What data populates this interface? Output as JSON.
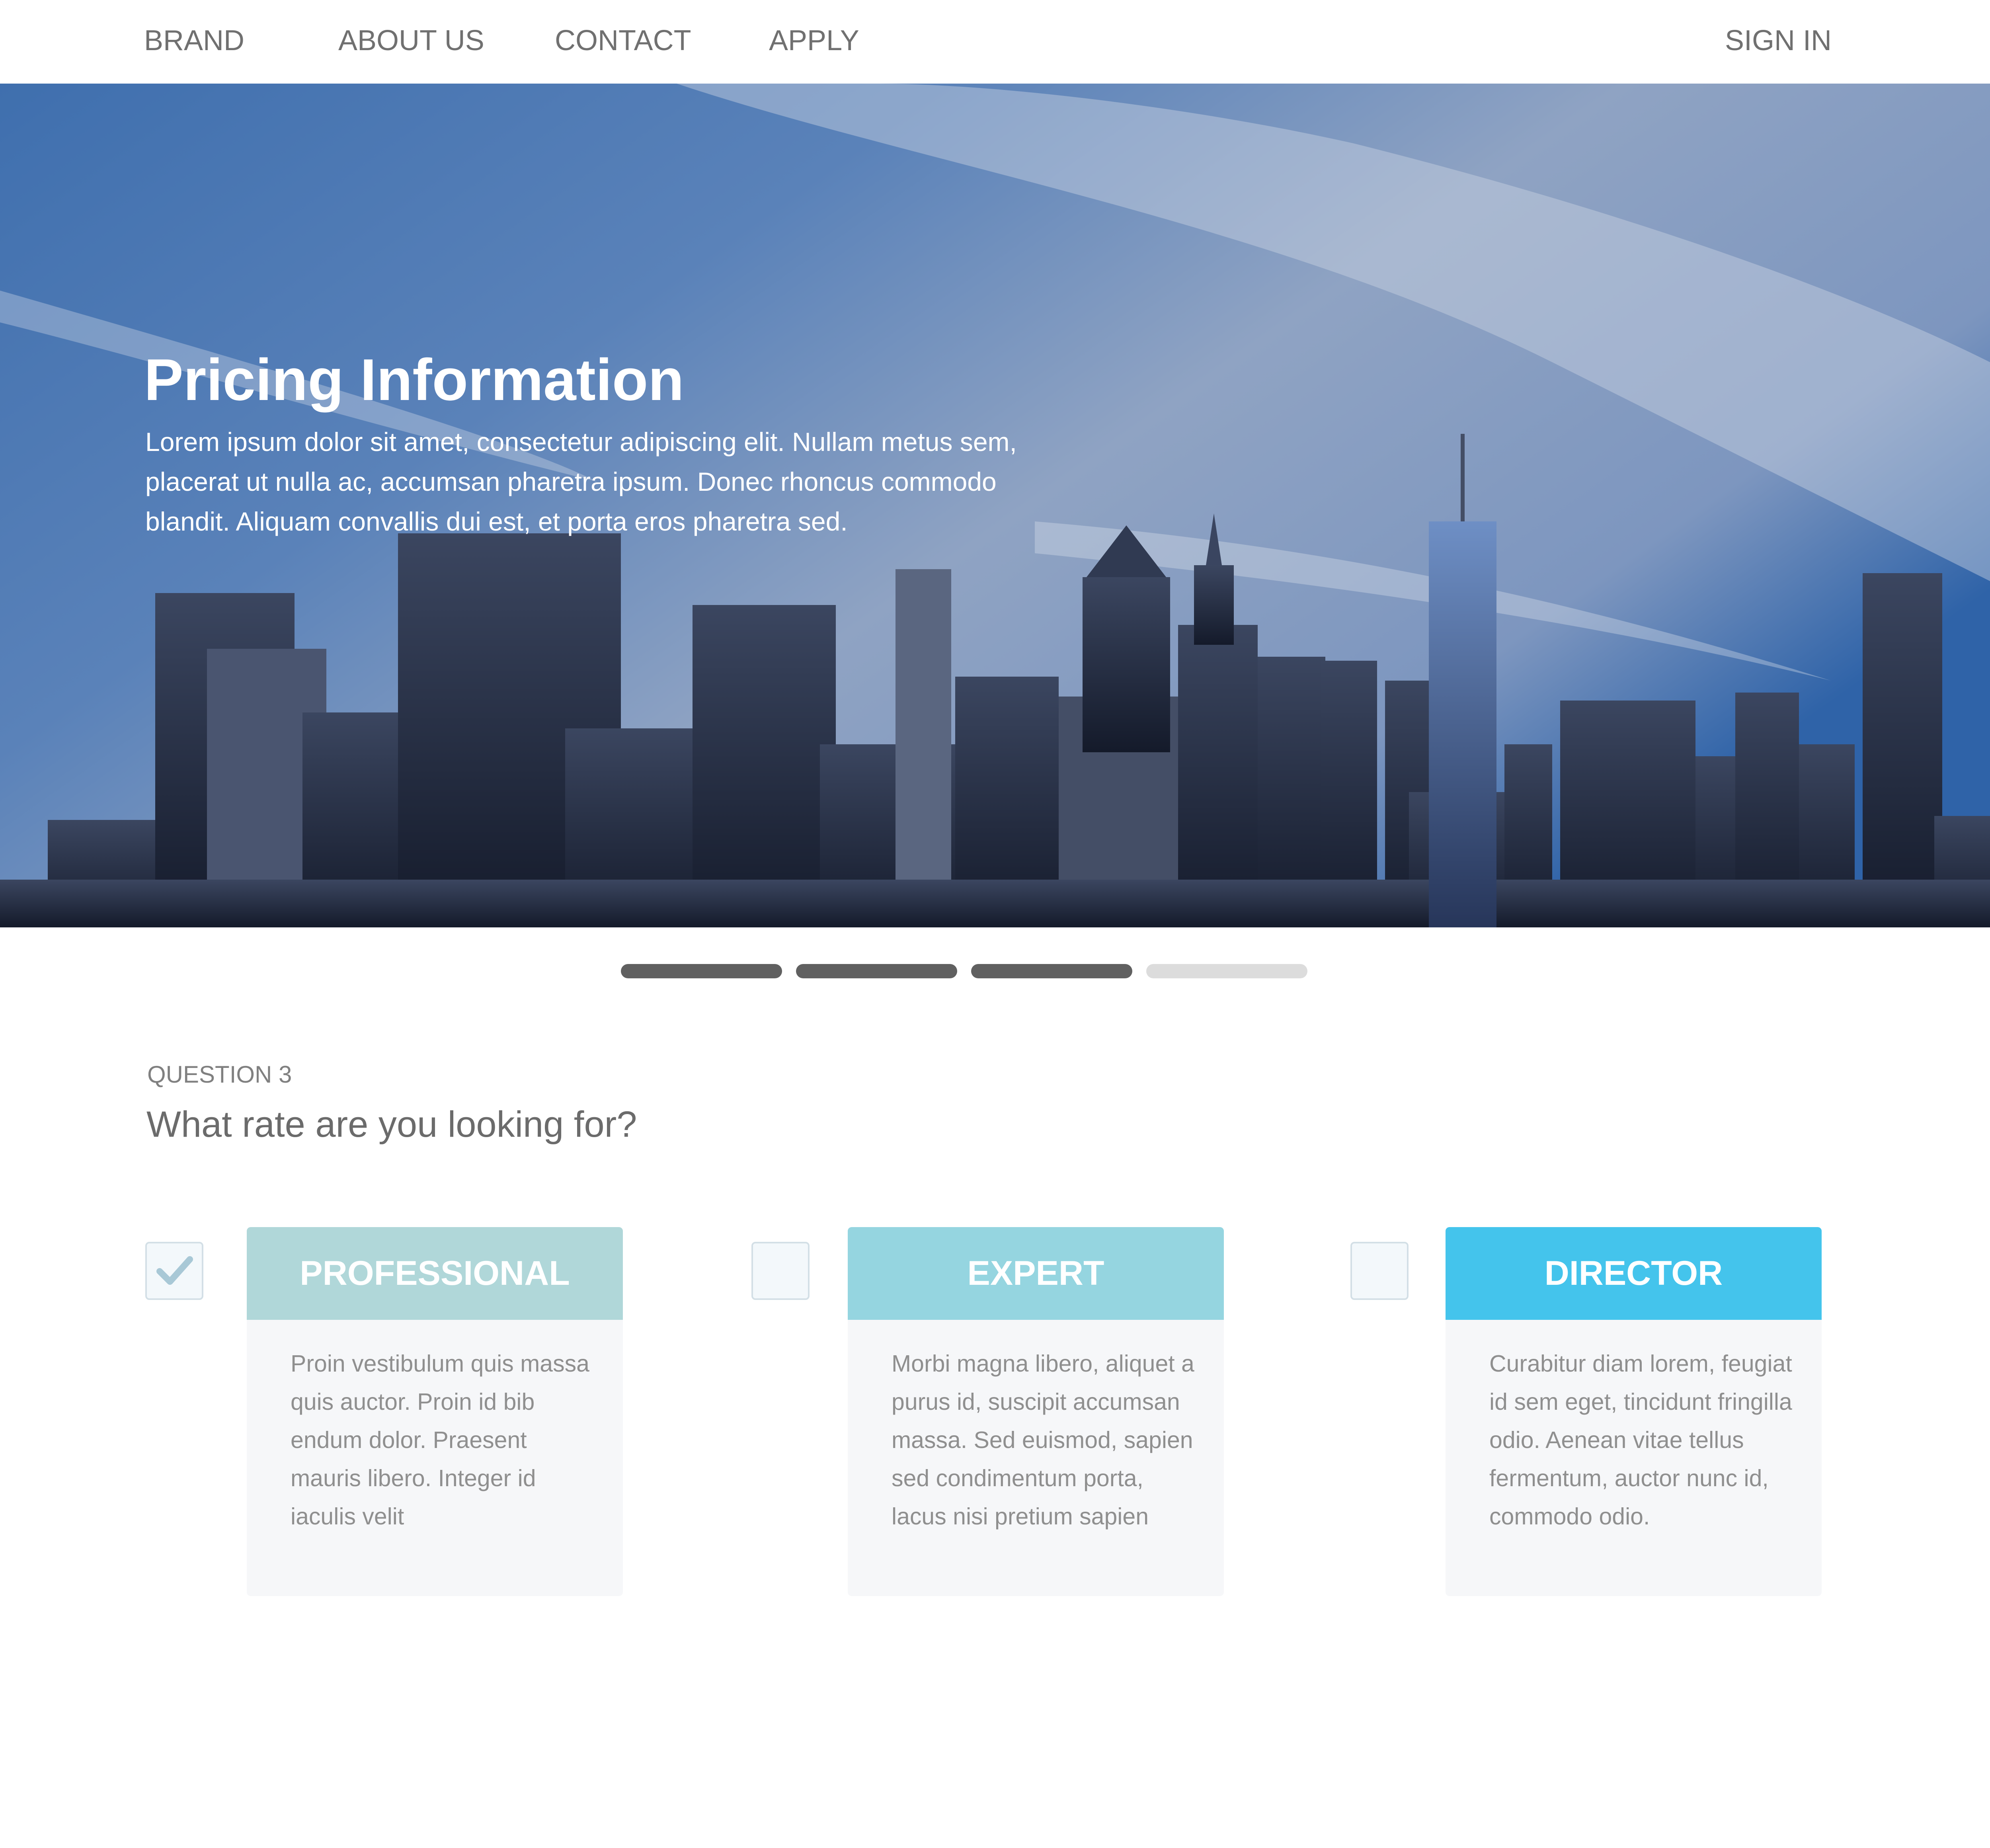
{
  "nav": {
    "brand": "BRAND",
    "items": [
      "ABOUT US",
      "CONTACT",
      "APPLY"
    ],
    "sign_in": "SIGN IN"
  },
  "hero": {
    "title": "Pricing Information",
    "description": "Lorem ipsum dolor sit amet, consectetur adipiscing elit. Nullam metus sem, placerat ut nulla ac, accumsan pharetra ipsum. Donec rhoncus commodo blandit. Aliquam convallis dui est, et porta eros pharetra sed."
  },
  "progress": {
    "total_steps": 4,
    "completed_steps": 3,
    "colors": {
      "done": "#606060",
      "todo": "#dcdcdc"
    }
  },
  "question": {
    "label": "QUESTION 3",
    "text": "What rate are you looking for?"
  },
  "options": [
    {
      "title": "PROFESSIONAL",
      "checked": true,
      "header_color": "#b0d7d9",
      "description": "Proin vestibulum quis massa quis auctor. Proin id bib endum dolor. Praesent mauris libero. Integer id iaculis velit"
    },
    {
      "title": "EXPERT",
      "checked": false,
      "header_color": "#95d5e0",
      "description": "Morbi magna libero, aliquet a purus id, suscipit accumsan massa. Sed euismod, sapien sed condimentum porta, lacus nisi pretium sapien"
    },
    {
      "title": "DIRECTOR",
      "checked": false,
      "header_color": "#44c4ec",
      "description": "Curabitur diam lorem, feugiat id sem eget, tincidunt fringilla odio. Aenean vitae tellus fermentum, auctor nunc id, commodo odio."
    }
  ],
  "icons": {
    "check": "checkmark-icon"
  }
}
